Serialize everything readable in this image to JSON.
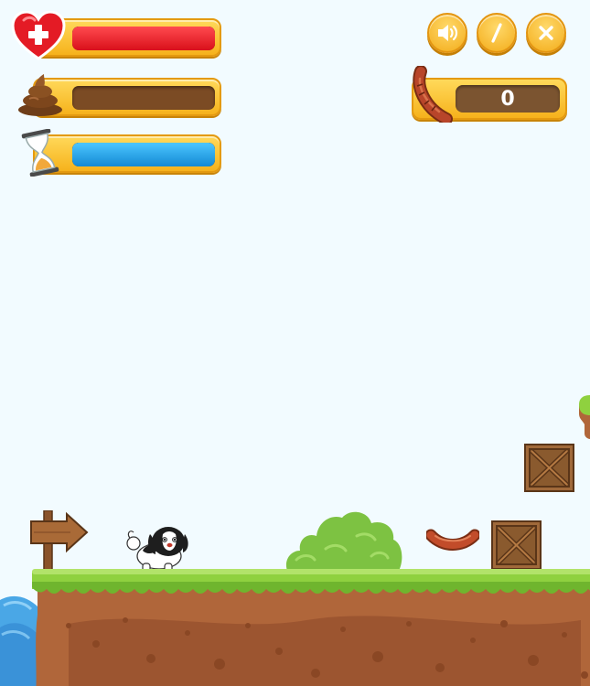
{
  "hud": {
    "health": {
      "icon": "heart-plus-icon",
      "fill_fraction": 1.0,
      "color": "#e8141f"
    },
    "hygiene": {
      "icon": "poop-icon",
      "fill_fraction": 0.0,
      "color": "#8a5a2c"
    },
    "time": {
      "icon": "hourglass-icon",
      "fill_fraction": 1.0,
      "color": "#1ba3e6"
    }
  },
  "controls": {
    "sound": {
      "icon": "speaker-icon"
    },
    "pause": {
      "icon": "slash-icon"
    },
    "close": {
      "icon": "close-icon"
    }
  },
  "score": {
    "icon": "sausage-icon",
    "value": "0"
  },
  "scene": {
    "player": "dog-icon",
    "pickup": "sausage-pickup-icon",
    "sign": "arrow-sign-icon",
    "bush": "bush-icon",
    "crates": [
      "crate-icon",
      "crate-icon"
    ]
  },
  "colors": {
    "frame": "#f6b21c",
    "grass": "#8fd13f",
    "dirt": "#b0663a",
    "water": "#4aa7e6"
  }
}
